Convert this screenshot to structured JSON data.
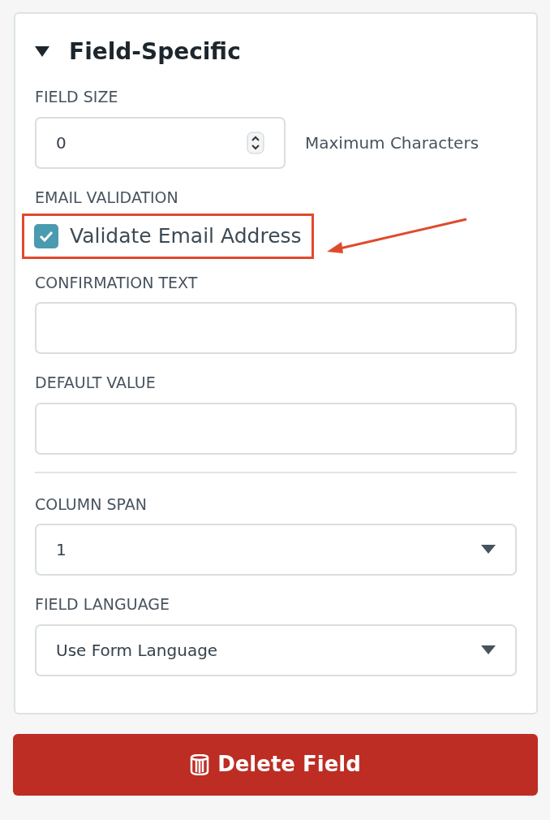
{
  "section": {
    "title": "Field-Specific",
    "expanded": true
  },
  "fields": [
    {
      "kind": "number",
      "label": "FIELD SIZE",
      "value": "0",
      "suffix": "Maximum Characters"
    },
    {
      "kind": "checkbox",
      "label": "EMAIL VALIDATION",
      "text": "Validate Email Address",
      "checked": true,
      "highlighted": true
    },
    {
      "kind": "text",
      "label": "CONFIRMATION TEXT"
    },
    {
      "kind": "text",
      "label": "DEFAULT VALUE"
    },
    {
      "kind": "divider"
    },
    {
      "kind": "select",
      "label": "COLUMN SPAN",
      "value": "1"
    },
    {
      "kind": "select",
      "label": "FIELD LANGUAGE",
      "value": "Use Form Language"
    }
  ],
  "delete_button": {
    "label": "Delete Field"
  }
}
